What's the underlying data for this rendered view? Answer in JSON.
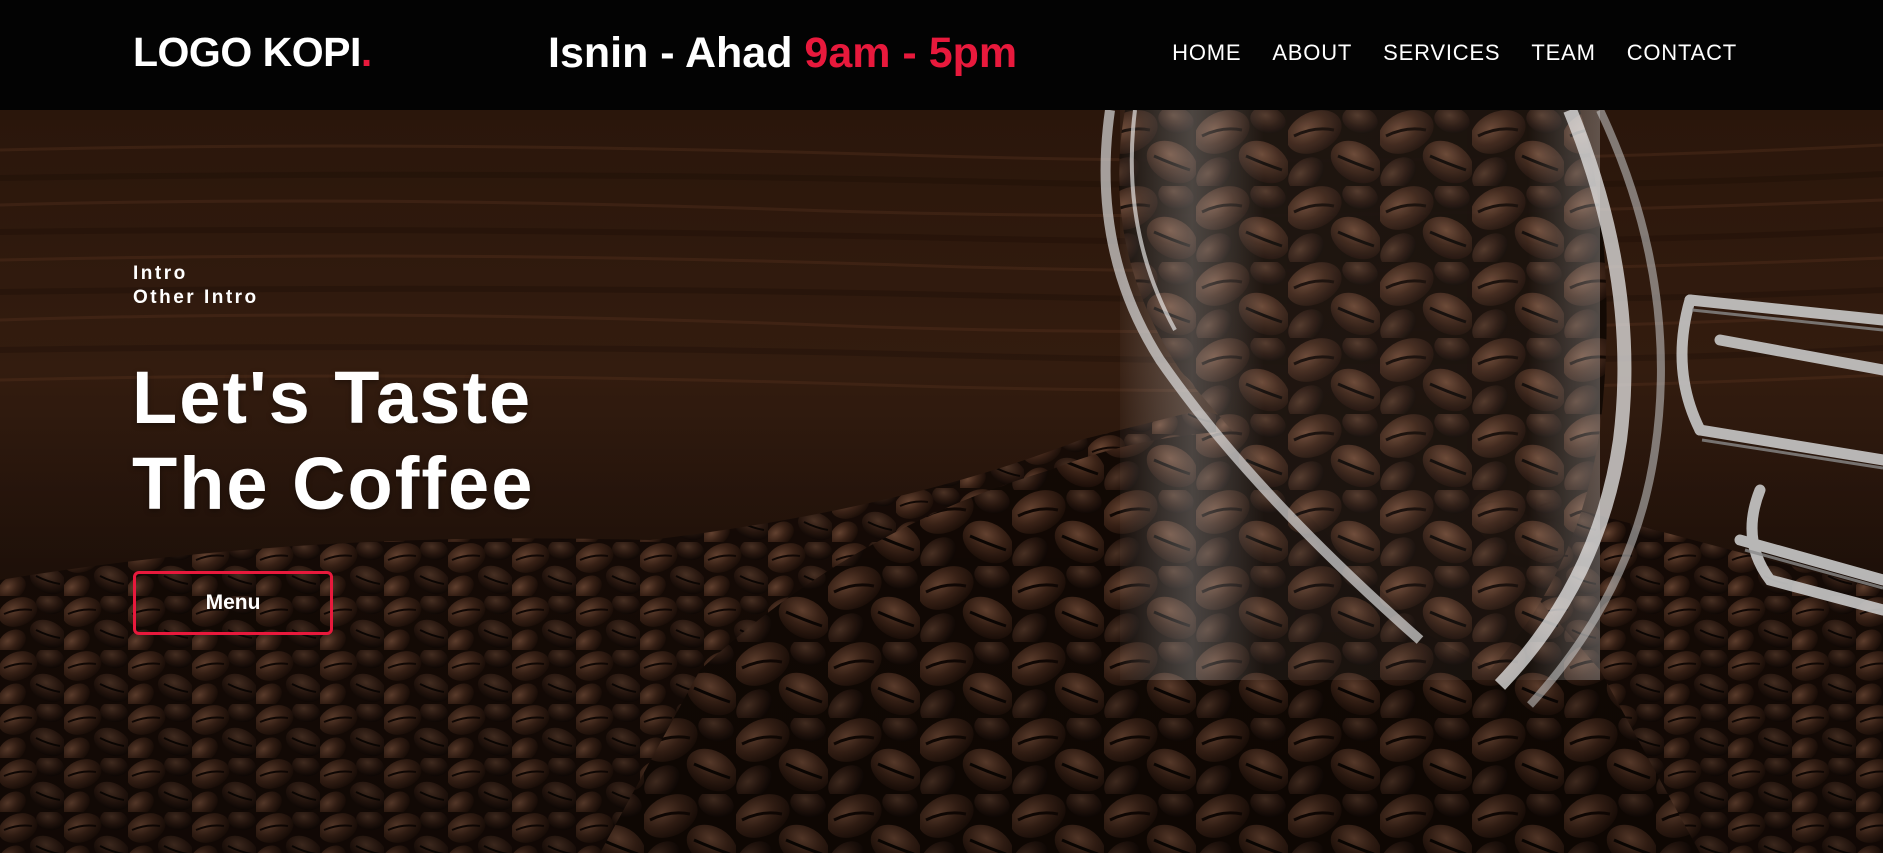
{
  "header": {
    "logo_text": "LOGO KOPI",
    "logo_dot": ".",
    "hours_days": "Isnin - Ahad",
    "hours_time": "9am - 5pm",
    "nav": [
      {
        "label": "HOME"
      },
      {
        "label": "ABOUT"
      },
      {
        "label": "SERVICES"
      },
      {
        "label": "TEAM"
      },
      {
        "label": "CONTACT"
      }
    ]
  },
  "hero": {
    "intro_line1": "Intro",
    "intro_line2": "Other Intro",
    "headline_line1": "Let's Taste",
    "headline_line2": "The Coffee",
    "menu_button": "Menu",
    "background_image": "coffee-beans-spilling-from-glass-jar"
  },
  "colors": {
    "accent": "#e8193c",
    "header_bg": "#030303",
    "text": "#ffffff"
  }
}
